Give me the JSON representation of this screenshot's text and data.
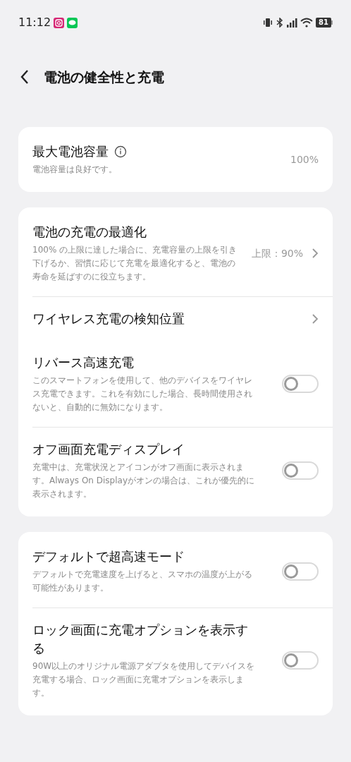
{
  "status_bar": {
    "time": "11:12",
    "battery": "81"
  },
  "header": {
    "title": "電池の健全性と充電"
  },
  "cards": [
    {
      "rows": [
        {
          "kind": "value",
          "title": "最大電池容量",
          "info": true,
          "description": "電池容量は良好です。",
          "value": "100%"
        }
      ]
    },
    {
      "rows": [
        {
          "kind": "nav",
          "title": "電池の充電の最適化",
          "description": "100% の上限に達した場合に、充電容量の上限を引き下げるか、習慣に応じて充電を最適化すると、電池の寿命を延ばすのに役立ちます。",
          "value": "上限：90%"
        },
        {
          "kind": "nav",
          "title": "ワイヤレス充電の検知位置"
        },
        {
          "kind": "toggle",
          "title": "リバース高速充電",
          "description": "このスマートフォンを使用して、他のデバイスをワイヤレス充電できます。これを有効にした場合、長時間使用されないと、自動的に無効になります。",
          "on": false
        },
        {
          "kind": "toggle",
          "title": "オフ画面充電ディスプレイ",
          "description": "充電中は、充電状況とアイコンがオフ画面に表示されます。Always On Displayがオンの場合は、これが優先的に表示されます。",
          "on": false
        }
      ]
    },
    {
      "rows": [
        {
          "kind": "toggle",
          "title": "デフォルトで超高速モード",
          "description": "デフォルトで充電速度を上げると、スマホの温度が上がる可能性があります。",
          "on": false
        },
        {
          "kind": "toggle",
          "title": "ロック画面に充電オプションを表示する",
          "description": "90W以上のオリジナル電源アダプタを使用してデバイスを充電する場合、ロック画面に充電オプションを表示します。",
          "on": false
        }
      ]
    }
  ]
}
